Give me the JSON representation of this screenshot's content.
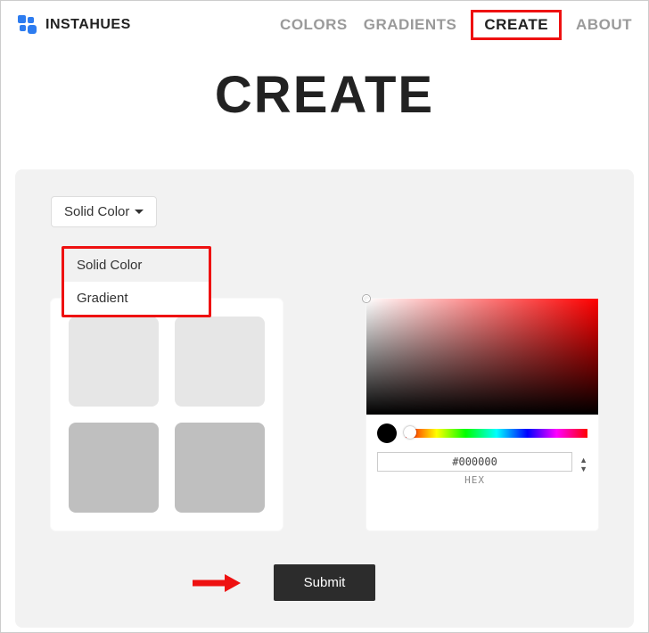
{
  "brand": {
    "name": "INSTAHUES"
  },
  "nav": {
    "items": [
      {
        "label": "COLORS",
        "active": false
      },
      {
        "label": "GRADIENTS",
        "active": false
      },
      {
        "label": "CREATE",
        "active": true
      },
      {
        "label": "ABOUT",
        "active": false
      }
    ]
  },
  "page": {
    "title": "CREATE"
  },
  "type_selector": {
    "selected": "Solid Color",
    "options": [
      "Solid Color",
      "Gradient"
    ]
  },
  "color_picker": {
    "hex_value": "#000000",
    "format_label": "HEX",
    "current_preview": "#000000"
  },
  "actions": {
    "submit_label": "Submit"
  }
}
